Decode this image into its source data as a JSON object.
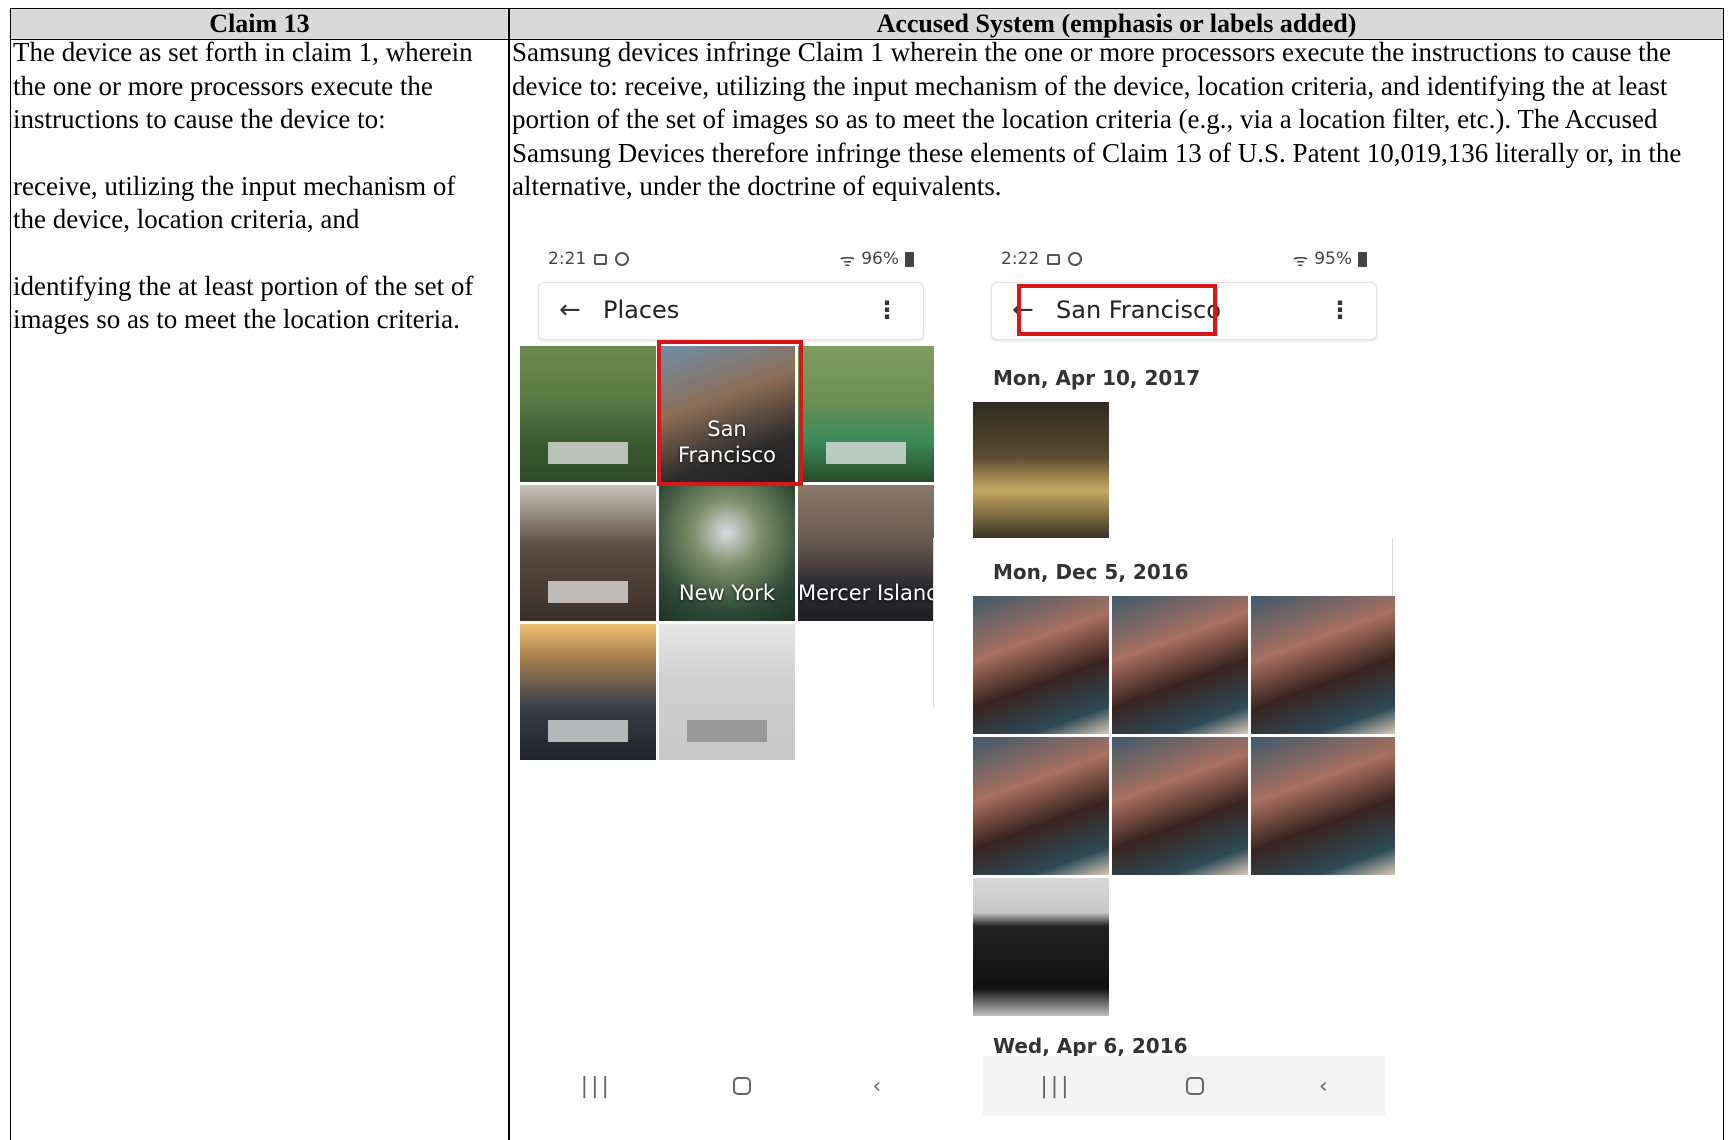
{
  "table": {
    "header_left": "Claim 13",
    "header_right": "Accused System (emphasis or labels added)",
    "left_paragraphs": [
      "The device as set forth in claim 1, wherein the one or more processors execute the instructions to cause the device to:",
      "receive, utilizing the input mechanism of the device, location criteria, and",
      "identifying the at least portion of the set of images so as to meet the location criteria."
    ],
    "right_paragraph": "Samsung devices infringe Claim 1 wherein the one or more processors execute the instructions to cause the device to: receive, utilizing the input mechanism of the device, location criteria, and identifying the at least portion of the set of images so as to meet the location criteria (e.g., via a location filter, etc.). The Accused Samsung Devices therefore infringe these elements of Claim 13 of U.S. Patent 10,019,136 literally or, in the alternative, under the doctrine of equivalents."
  },
  "phone1": {
    "time": "2:21",
    "battery": "96%",
    "title": "Places",
    "tiles": [
      {
        "label": ""
      },
      {
        "label": "San\nFrancisco"
      },
      {
        "label": ""
      },
      {
        "label": ""
      },
      {
        "label": "New York"
      },
      {
        "label": "Mercer Island"
      },
      {
        "label": ""
      },
      {
        "label": ""
      }
    ],
    "san_francisco_label": "San Francisco",
    "new_york_label": "New York",
    "mercer_label": "Mercer Island"
  },
  "phone2": {
    "time": "2:22",
    "battery": "95%",
    "title": "San Francisco",
    "dates": [
      "Mon, Apr 10, 2017",
      "Mon, Dec 5, 2016",
      "Wed, Apr 6, 2016"
    ]
  },
  "icons": {
    "back": "back-arrow-icon",
    "more": "more-vert-icon",
    "recents": "recent-apps-icon",
    "home": "home-icon",
    "nav_back": "nav-back-icon"
  },
  "colors": {
    "header_bg": "#d9d9d9",
    "highlight_red": "#d9161a"
  }
}
